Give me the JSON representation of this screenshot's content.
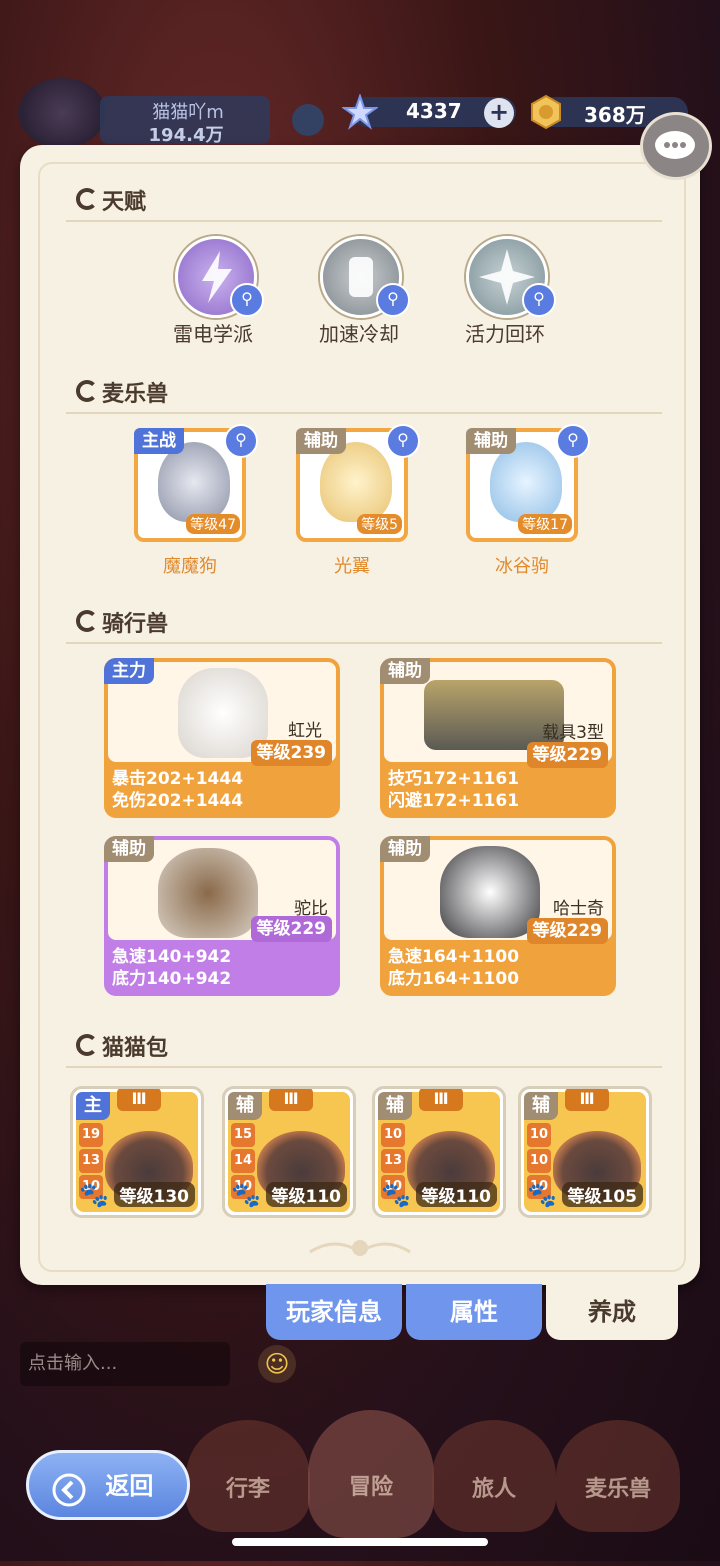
{
  "header": {
    "player_name": "猫猫吖m",
    "power": "194.4万",
    "star_currency": "4337",
    "gold_currency": "368万",
    "add_button": "+"
  },
  "sections": {
    "talent": "天赋",
    "pets": "麦乐兽",
    "mounts": "骑行兽",
    "bags": "猫猫包"
  },
  "talents": [
    {
      "name": "雷电学派",
      "color": "#a98ad8"
    },
    {
      "name": "加速冷却",
      "color": "#8f9aa0"
    },
    {
      "name": "活力回环",
      "color": "#8aa2a8"
    }
  ],
  "pets": [
    {
      "tag": "主战",
      "level": "等级47",
      "name": "魔魔狗",
      "tag_color": "#4f73d8"
    },
    {
      "tag": "辅助",
      "level": "等级5",
      "name": "光翼",
      "tag_color": "#a18d72"
    },
    {
      "tag": "辅助",
      "level": "等级17",
      "name": "冰谷驹",
      "tag_color": "#a18d72"
    }
  ],
  "mounts": [
    {
      "tag": "主力",
      "name": "虹光",
      "level": "等级239",
      "stat1": "暴击202+1444",
      "stat2": "免伤202+1444",
      "color": "#f0a23d",
      "tag_color": "#4f73d8"
    },
    {
      "tag": "辅助",
      "name": "载具3型",
      "level": "等级229",
      "stat1": "技巧172+1161",
      "stat2": "闪避172+1161",
      "color": "#f0a23d",
      "tag_color": "#a18d72"
    },
    {
      "tag": "辅助",
      "name": "驼比",
      "level": "等级229",
      "stat1": "急速140+942",
      "stat2": "底力140+942",
      "color": "#c07ee6",
      "tag_color": "#a18d72"
    },
    {
      "tag": "辅助",
      "name": "哈士奇",
      "level": "等级229",
      "stat1": "急速164+1100",
      "stat2": "底力164+1100",
      "color": "#f0a23d",
      "tag_color": "#a18d72"
    }
  ],
  "bags": [
    {
      "role": "主",
      "tier": "Ⅲ",
      "nums": [
        "19",
        "13",
        "10"
      ],
      "level": "等级130",
      "role_color": "#4f73d8"
    },
    {
      "role": "辅",
      "tier": "Ⅲ",
      "nums": [
        "15",
        "14",
        "10"
      ],
      "level": "等级110",
      "role_color": "#a18d72"
    },
    {
      "role": "辅",
      "tier": "Ⅲ",
      "nums": [
        "10",
        "13",
        "10"
      ],
      "level": "等级110",
      "role_color": "#a18d72"
    },
    {
      "role": "辅",
      "tier": "Ⅲ",
      "nums": [
        "10",
        "10",
        "10"
      ],
      "level": "等级105",
      "role_color": "#a18d72"
    }
  ],
  "tabs": [
    {
      "label": "玩家信息"
    },
    {
      "label": "属性"
    },
    {
      "label": "养成"
    }
  ],
  "chat_input": {
    "placeholder": "点击输入..."
  },
  "bottom_nav": [
    {
      "label": "行李"
    },
    {
      "label": "冒险"
    },
    {
      "label": "旅人"
    },
    {
      "label": "麦乐兽"
    }
  ],
  "back_button": "返回",
  "icons": {
    "star": "star-icon",
    "coin": "coin-icon",
    "chat": "chat-bubble-icon",
    "search": "magnifier-icon"
  }
}
